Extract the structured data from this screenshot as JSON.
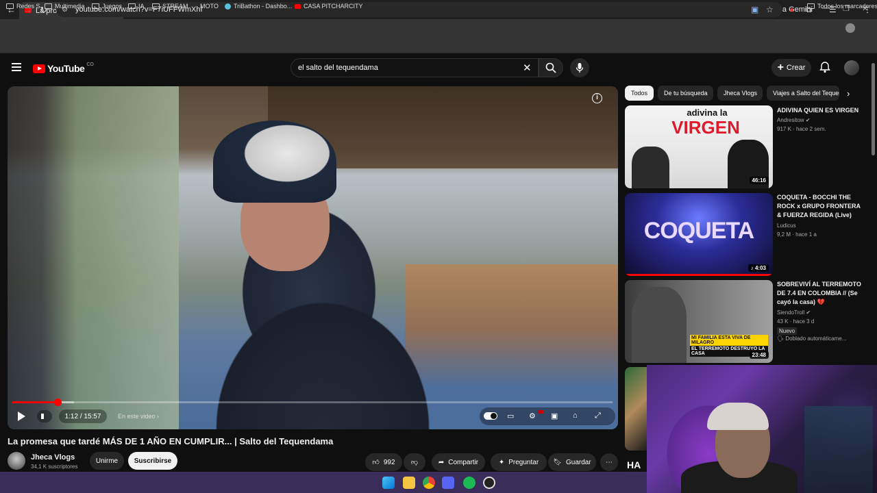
{
  "browser": {
    "tab_title": "La promesa que tardé MÁS DE",
    "tab_close": "✕",
    "new_tab": "+",
    "gemini_label": "Pregunta a Gemini",
    "url": "youtube.com/watch?v=F7iUFFWmXhI",
    "bookmarks": [
      "Redes S",
      "Multimedia",
      "Juegos",
      "IA",
      "STREAM",
      "MOTO",
      "TriBathon - Dashbo...",
      "CASA PITCHARCITY"
    ],
    "all_bookmarks": "Todos los marcadores"
  },
  "youtube": {
    "logo_word": "YouTube",
    "logo_country": "CO",
    "search_query": "el salto del tequendama",
    "create_label": "Crear"
  },
  "player": {
    "current_time": "1:12",
    "duration": "15:57",
    "time_display": "1:12 / 15:57",
    "progress_fraction": 0.075,
    "buffered_fraction": 0.103,
    "chapter_label": "En este video",
    "info_icon": "i"
  },
  "video": {
    "title": "La promesa que tardé MÁS DE 1 AÑO EN CUMPLIR... | Salto del Tequendama",
    "channel": "Jheca Vlogs",
    "subscribers": "34,1 K suscriptores",
    "join_label": "Unirme",
    "subscribe_label": "Suscribirse",
    "likes": "992",
    "share_label": "Compartir",
    "ask_label": "Preguntar",
    "save_label": "Guardar"
  },
  "chips": [
    "Todos",
    "De tu búsqueda",
    "Jheca Vlogs",
    "Viajes a Salto del Tequendama"
  ],
  "related": [
    {
      "title": "ADIVINA QUIEN ES VIRGEN",
      "channel": "Andresitow",
      "meta": "917 K · hace 2 sem.",
      "duration": "46:16",
      "thumb_text_1": "adivina la",
      "thumb_text_2": "VIRGEN"
    },
    {
      "title": "COQUETA - BOCCHI THE ROCK x GRUPO FRONTERA & FUERZA REGIDA (Live)",
      "channel": "Ludicus",
      "meta": "9,2 M · hace 1 a",
      "duration": "4:03",
      "thumb_text_1": "COQUETA"
    },
    {
      "title": "SOBREVIVÍ AL TERREMOTO DE 7.4 EN COLOMBIA // (Se cayó la casa) 💔",
      "channel": "SiendoTroll",
      "meta": "43 K · hace 3 d",
      "badge": "Nuevo",
      "dubbed": "Doblado automáticame...",
      "duration": "23:48",
      "thumb_text_1": "MI FAMILIA ESTA VIVA DE MILAGRO",
      "thumb_text_2": "EL TERREMOTO DESTRUYO LA CASA"
    }
  ],
  "peek_text": "HA",
  "colors": {
    "yt_red": "#ff0000",
    "bg": "#0f0f0f",
    "chip_bg": "#272727"
  }
}
